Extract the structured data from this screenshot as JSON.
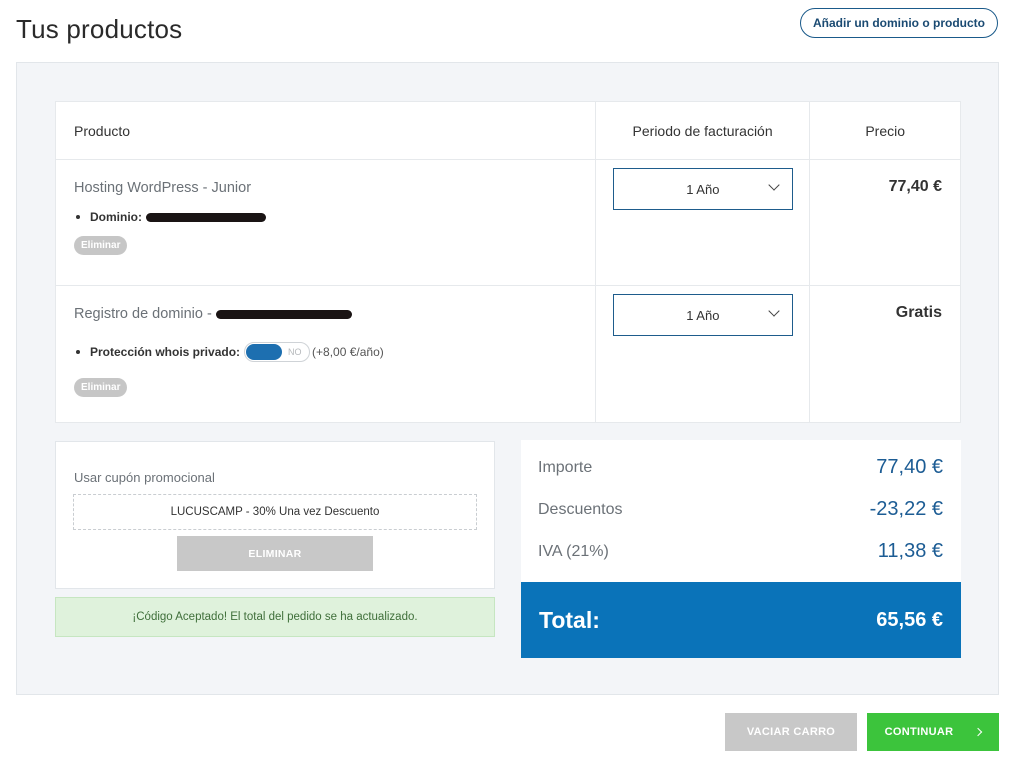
{
  "header": {
    "title": "Tus productos",
    "add_button": "Añadir un dominio o producto"
  },
  "table": {
    "headers": {
      "product": "Producto",
      "period": "Periodo de facturación",
      "price": "Precio"
    },
    "rows": [
      {
        "name": "Hosting WordPress - Junior",
        "detail_label": "Dominio:",
        "period": "1 Año",
        "price": "77,40 €",
        "remove_label": "Eliminar"
      },
      {
        "name": "Registro de dominio -",
        "detail_label": "Protección whois privado:",
        "toggle_state": "NO",
        "toggle_price": "(+8,00 €/año)",
        "period": "1 Año",
        "price": "Gratis",
        "remove_label": "Eliminar"
      }
    ]
  },
  "coupon": {
    "label": "Usar cupón promocional",
    "value": "LUCUSCAMP - 30% Una vez Descuento",
    "remove_label": "ELIMINAR",
    "success_message": "¡Código Aceptado! El total del pedido se ha actualizado."
  },
  "summary": {
    "amount_label": "Importe",
    "amount": "77,40 €",
    "discount_label": "Descuentos",
    "discount": "-23,22 €",
    "tax_label": "IVA (21%)",
    "tax": "11,38 €",
    "total_label": "Total:",
    "total": "65,56 €"
  },
  "actions": {
    "empty_cart": "VACIAR CARRO",
    "continue": "CONTINUAR"
  },
  "colors": {
    "accent_blue": "#0a73b9",
    "success_green": "#3cc43c"
  }
}
